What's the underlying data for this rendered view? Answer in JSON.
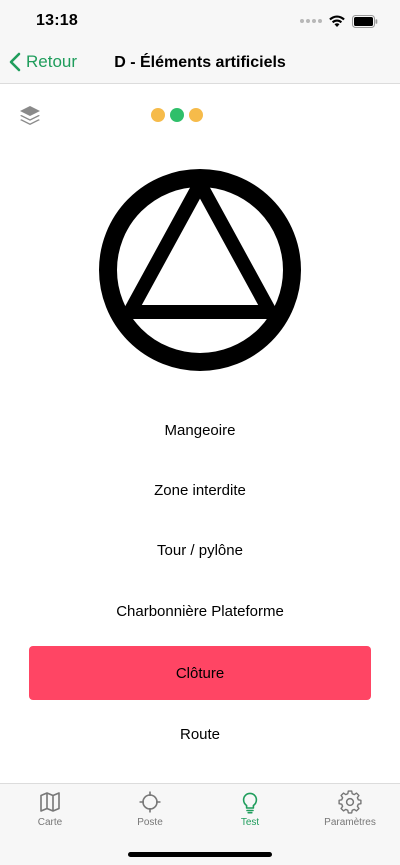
{
  "status_bar": {
    "time": "13:18"
  },
  "nav": {
    "back_label": "Retour",
    "title": "D - Éléments artificiels"
  },
  "progress": {
    "colors": [
      "#f6bb4a",
      "#2fbf6a",
      "#f6bb4a"
    ]
  },
  "answers": [
    {
      "label": "Mangeoire",
      "selected": false
    },
    {
      "label": "Zone interdite",
      "selected": false
    },
    {
      "label": "Tour / pylône",
      "selected": false
    },
    {
      "label": "Charbonnière Plateforme",
      "selected": false
    },
    {
      "label": "Clôture",
      "selected": true
    },
    {
      "label": "Route",
      "selected": false
    }
  ],
  "tabs": [
    {
      "label": "Carte",
      "icon": "map-icon",
      "active": false
    },
    {
      "label": "Poste",
      "icon": "crosshair-icon",
      "active": false
    },
    {
      "label": "Test",
      "icon": "lightbulb-icon",
      "active": true
    },
    {
      "label": "Paramètres",
      "icon": "gear-icon",
      "active": false
    }
  ],
  "colors": {
    "accent": "#1f9d5c",
    "selected": "#ff4564",
    "dot_warning": "#f6bb4a",
    "dot_ok": "#2fbf6a"
  }
}
